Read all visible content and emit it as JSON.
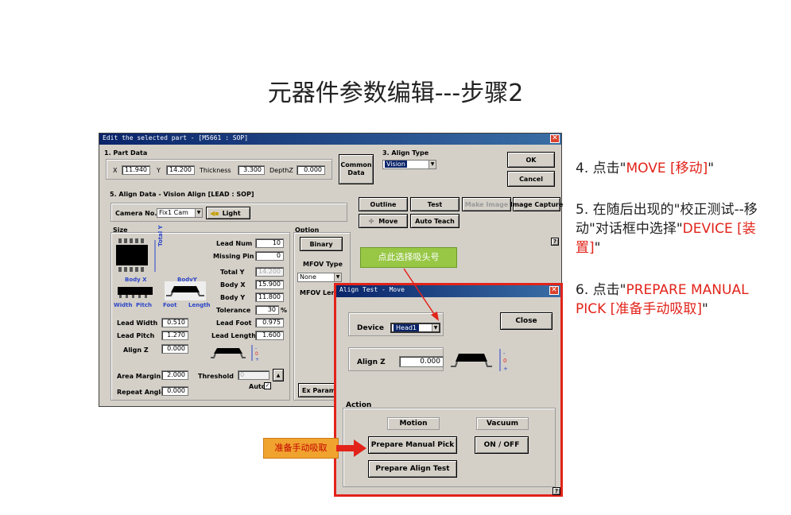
{
  "slide": {
    "title": "元器件参数编辑---步骤2"
  },
  "main_dialog": {
    "title": "Edit the selected part - [M5661 : SOP]",
    "part_data": {
      "heading": "1. Part Data",
      "x_label": "X",
      "x_value": "11.940",
      "y_label": "Y",
      "y_value": "14.200",
      "thickness_label": "Thickness",
      "thickness_value": "3.300",
      "depthz_label": "DepthZ",
      "depthz_value": "0.000"
    },
    "common_data_label": "Common Data",
    "align_type": {
      "heading": "3. Align Type",
      "value": "Vision"
    },
    "ok_label": "OK",
    "cancel_label": "Cancel",
    "align_data": {
      "heading": "5. Align Data - Vision Align [LEAD : SOP]",
      "camera_label": "Camera No.",
      "camera_value": "Fix1 Cam",
      "light_label": "Light"
    },
    "buttons": {
      "outline": "Outline",
      "test": "Test",
      "make_image": "Make Image",
      "image_capture": "Image Capture",
      "move": "Move",
      "auto_teach": "Auto Teach",
      "help": "?"
    },
    "size": {
      "heading": "Size",
      "total_y_vertical": "Total Y",
      "body_x_caption": "Body X",
      "body_y_caption": "BodyY",
      "width_caption": "Width",
      "pitch_caption": "Pitch",
      "foot_caption": "Foot",
      "length_caption": "Length",
      "lead_num_label": "Lead Num",
      "lead_num_value": "10",
      "missing_pin_label": "Missing Pin",
      "missing_pin_value": "0",
      "total_y_label": "Total Y",
      "total_y_value": "14.200",
      "body_x_label": "Body X",
      "body_x_value": "15.900",
      "body_y_label": "Body Y",
      "body_y_value": "11.800",
      "tolerance_label": "Tolerance",
      "tolerance_value": "30",
      "tolerance_unit": "%",
      "lead_width_label": "Lead Width",
      "lead_width_value": "0.510",
      "lead_pitch_label": "Lead Pitch",
      "lead_pitch_value": "1.270",
      "lead_foot_label": "Lead Foot",
      "lead_foot_value": "0.975",
      "lead_length_label": "Lead Length",
      "lead_length_value": "1.600",
      "align_z_label": "Align Z",
      "align_z_value": "0.000",
      "area_margin_label": "Area Margin",
      "area_margin_value": "2.000",
      "threshold_label": "Threshold",
      "threshold_value": "0",
      "repeat_angle_label": "Repeat Angle",
      "repeat_angle_value": "0.000",
      "auto_label": "Auto"
    },
    "option": {
      "heading": "Option",
      "binary_label": "Binary",
      "mfov_type_label": "MFOV Type",
      "mfov_type_value": "None",
      "mfov_leng_label": "MFOV Leng",
      "ex_param_label": "Ex Param"
    }
  },
  "align_test_dialog": {
    "title": "Align Test - Move",
    "device_label": "Device",
    "device_value": "Head1",
    "close_label": "Close",
    "align_z_label": "Align Z",
    "align_z_value": "0.000",
    "action_heading": "Action",
    "motion_label": "Motion",
    "vacuum_label": "Vacuum",
    "prepare_manual_pick_label": "Prepare Manual Pick",
    "on_off_label": "ON / OFF",
    "prepare_align_test_label": "Prepare Align Test",
    "help": "?"
  },
  "callouts": {
    "select_head": "点此选择吸头号",
    "prepare_pick": "准备手动吸取"
  },
  "instructions": {
    "step4_prefix": "4. 点击\"",
    "step4_red": "MOVE [移动]",
    "step4_suffix": "\"",
    "step5_prefix": "5. 在随后出现的\"校正测试--移动\"对话框中选择\"",
    "step5_red": "DEVICE [装置]",
    "step5_suffix": "\"",
    "step6_prefix": "6. 点击\"",
    "step6_red": "PREPARE MANUAL PICK [准备手动吸取]",
    "step6_suffix": "\""
  },
  "colors": {
    "title_bar": "#0a246a",
    "highlight_red": "#e2231a",
    "callout_green": "#97c745",
    "callout_orange": "#f0a32e",
    "selection_blue": "#0a246a"
  }
}
